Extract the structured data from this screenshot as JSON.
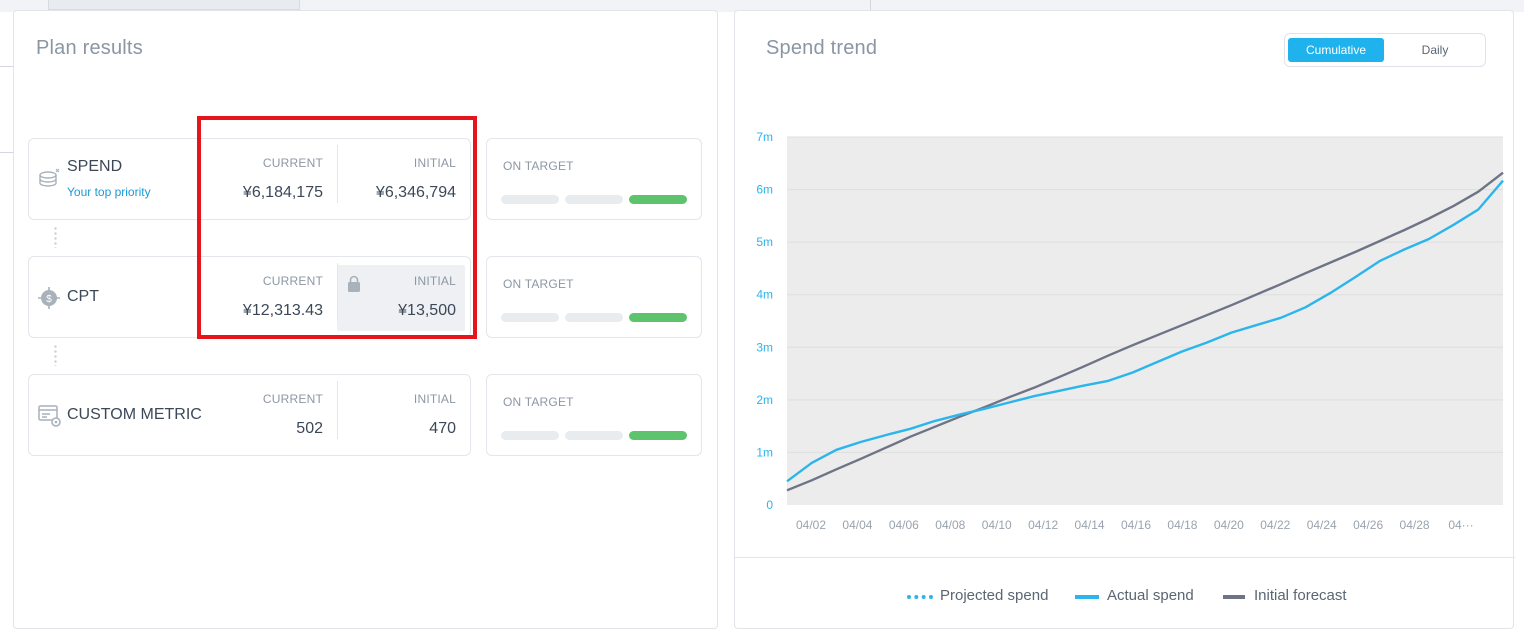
{
  "plan": {
    "title": "Plan results",
    "metrics": [
      {
        "name": "SPEND",
        "subtitle": "Your top priority",
        "current_label": "CURRENT",
        "current_value": "¥6,184,175",
        "initial_label": "INITIAL",
        "initial_value": "¥6,346,794",
        "status": "ON TARGET",
        "icon": "coins-icon"
      },
      {
        "name": "CPT",
        "current_label": "CURRENT",
        "current_value": "¥12,313.43",
        "initial_label": "INITIAL",
        "initial_value": "¥13,500",
        "status": "ON TARGET",
        "icon": "cost-target-icon",
        "locked": true
      },
      {
        "name": "CUSTOM METRIC",
        "current_label": "CURRENT",
        "current_value": "502",
        "initial_label": "INITIAL",
        "initial_value": "470",
        "status": "ON TARGET",
        "icon": "custom-metric-icon"
      }
    ]
  },
  "trend": {
    "title": "Spend trend",
    "toggle": {
      "cumulative": "Cumulative",
      "daily": "Daily",
      "selected": "Cumulative"
    },
    "legend": {
      "projected": "Projected spend",
      "actual": "Actual spend",
      "forecast": "Initial forecast"
    },
    "colors": {
      "actual": "#2bb5ec",
      "forecast": "#6e7486",
      "on_target": "#5dc46d",
      "accent": "#1fb2ec",
      "highlight": "#e8141b"
    }
  },
  "chart_data": {
    "type": "line",
    "y_tick_labels": [
      "0",
      "1m",
      "2m",
      "3m",
      "4m",
      "5m",
      "6m",
      "7m"
    ],
    "ylim": [
      0,
      7000000
    ],
    "x_tick_labels": [
      "04/02",
      "04/04",
      "04/06",
      "04/08",
      "04/10",
      "04/12",
      "04/14",
      "04/16",
      "04/18",
      "04/20",
      "04/22",
      "04/24",
      "04/26",
      "04/28",
      "04···"
    ],
    "x": [
      1,
      2,
      3,
      4,
      5,
      6,
      7,
      8,
      9,
      10,
      11,
      12,
      13,
      14,
      15,
      16,
      17,
      18,
      19,
      20,
      21,
      22,
      23,
      24,
      25,
      26,
      27,
      28,
      29,
      30
    ],
    "series": [
      {
        "name": "Actual spend",
        "values": [
          450000,
          800000,
          1050000,
          1200000,
          1330000,
          1450000,
          1600000,
          1720000,
          1830000,
          1950000,
          2070000,
          2170000,
          2270000,
          2360000,
          2520000,
          2720000,
          2920000,
          3090000,
          3280000,
          3420000,
          3560000,
          3760000,
          4030000,
          4330000,
          4640000,
          4860000,
          5060000,
          5330000,
          5620000,
          6170000
        ]
      },
      {
        "name": "Initial forecast",
        "values": [
          280000,
          470000,
          680000,
          880000,
          1090000,
          1300000,
          1490000,
          1680000,
          1860000,
          2050000,
          2230000,
          2430000,
          2630000,
          2840000,
          3040000,
          3230000,
          3420000,
          3610000,
          3800000,
          4000000,
          4200000,
          4410000,
          4610000,
          4810000,
          5020000,
          5230000,
          5450000,
          5690000,
          5960000,
          6320000
        ]
      }
    ]
  }
}
